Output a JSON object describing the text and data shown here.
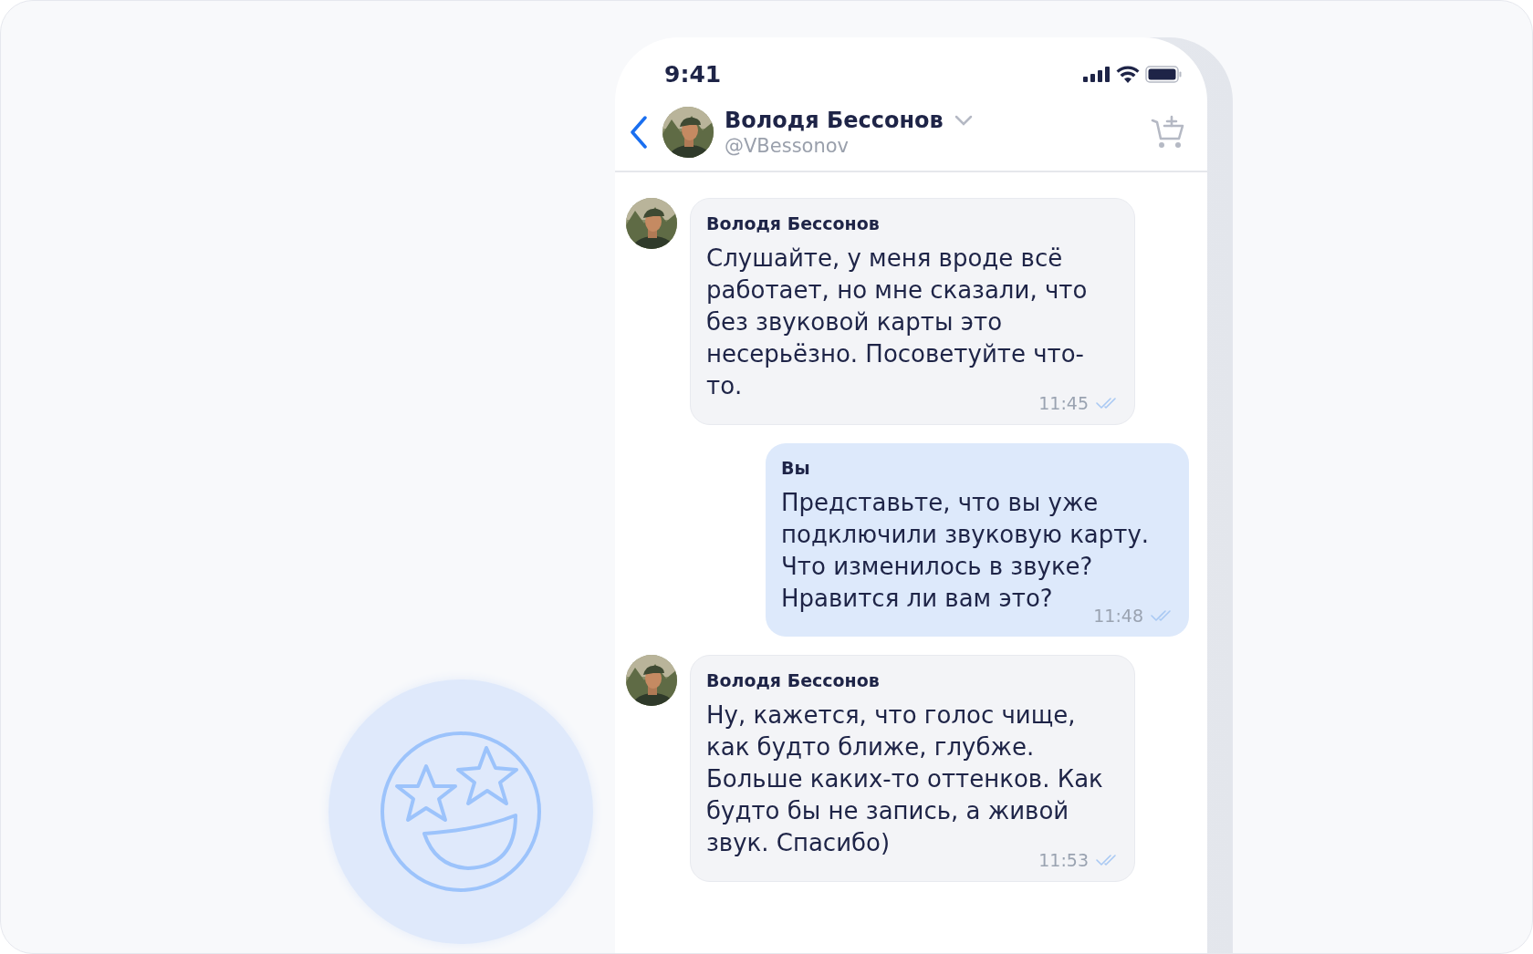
{
  "status_bar": {
    "time": "9:41"
  },
  "chat_header": {
    "name": "Володя Бессонов",
    "handle": "@VBessonov"
  },
  "messages": [
    {
      "kind": "incoming",
      "author": "Володя Бессонов",
      "text": "Слушайте, у меня вроде всё работает, но мне сказали, что без звуковой карты это несерьёзно. Посоветуйте что-то.",
      "time": "11:45"
    },
    {
      "kind": "outgoing",
      "author": "Вы",
      "text": "Представьте, что вы уже подключили звуковую карту. Что изменилось в звуке? Нравится ли вам это?",
      "time": "11:48"
    },
    {
      "kind": "incoming",
      "author": "Володя Бессонов",
      "text": "Ну, кажется, что голос чище, как будто ближе, глубже. Больше каких-то оттенков. Как будто бы не запись, а живой звук. Спасибо)",
      "time": "11:53"
    }
  ]
}
